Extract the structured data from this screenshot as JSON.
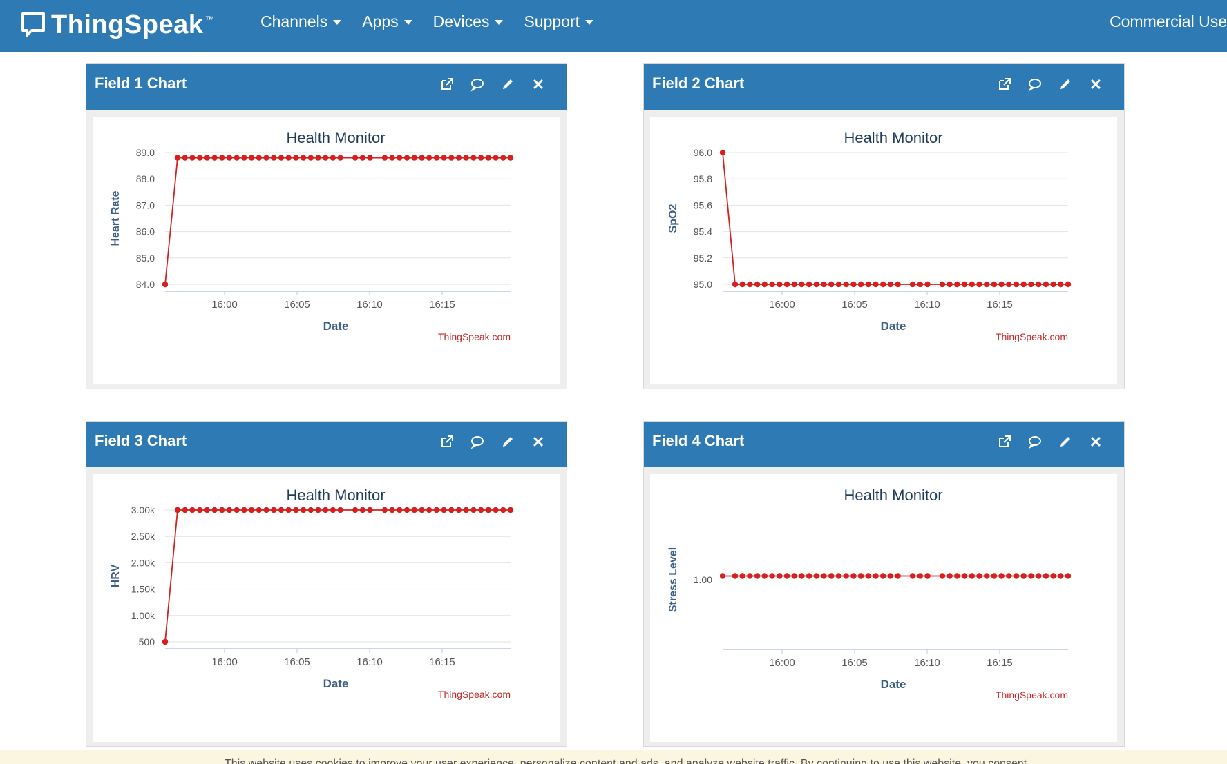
{
  "navbar": {
    "brand": "ThingSpeak",
    "brand_tm": "™",
    "items": [
      {
        "label": "Channels"
      },
      {
        "label": "Apps"
      },
      {
        "label": "Devices"
      },
      {
        "label": "Support"
      }
    ],
    "right_label": "Commercial Use"
  },
  "panels": [
    {
      "title": "Field 1 Chart",
      "tools": [
        "external-link-icon",
        "comment-icon",
        "pencil-icon",
        "close-icon"
      ]
    },
    {
      "title": "Field 2 Chart",
      "tools": [
        "external-link-icon",
        "comment-icon",
        "pencil-icon",
        "close-icon"
      ]
    },
    {
      "title": "Field 3 Chart",
      "tools": [
        "external-link-icon",
        "comment-icon",
        "pencil-icon",
        "close-icon"
      ]
    },
    {
      "title": "Field 4 Chart",
      "tools": [
        "external-link-icon",
        "comment-icon",
        "pencil-icon",
        "close-icon"
      ]
    }
  ],
  "chart_data": [
    {
      "type": "line",
      "title": "Health Monitor",
      "xlabel": "Date",
      "ylabel": "Heart Rate",
      "credit": "ThingSpeak.com",
      "x_ticks": [
        "16:00",
        "16:05",
        "16:10",
        "16:15"
      ],
      "y_ticks": [
        "89.0",
        "88.0",
        "87.0",
        "86.0",
        "85.0",
        "84.0"
      ],
      "ylim": [
        84,
        89
      ],
      "color": "#d62020",
      "series": [
        {
          "first": 84.0,
          "rest": 88.8
        }
      ]
    },
    {
      "type": "line",
      "title": "Health Monitor",
      "xlabel": "Date",
      "ylabel": "SpO2",
      "credit": "ThingSpeak.com",
      "x_ticks": [
        "16:00",
        "16:05",
        "16:10",
        "16:15"
      ],
      "y_ticks": [
        "96.0",
        "95.8",
        "95.6",
        "95.4",
        "95.2",
        "95.0"
      ],
      "ylim": [
        95,
        96
      ],
      "color": "#d62020",
      "series": [
        {
          "first": 96.0,
          "rest": 95.0
        }
      ]
    },
    {
      "type": "line",
      "title": "Health Monitor",
      "xlabel": "Date",
      "ylabel": "HRV",
      "credit": "ThingSpeak.com",
      "x_ticks": [
        "16:00",
        "16:05",
        "16:10",
        "16:15"
      ],
      "y_ticks": [
        "3.00k",
        "2.50k",
        "2.00k",
        "1.50k",
        "1.00k",
        "500"
      ],
      "ylim": [
        200,
        3000
      ],
      "color": "#d62020",
      "series": [
        {
          "first": 200,
          "rest": 3000
        }
      ]
    },
    {
      "type": "line",
      "title": "Health Monitor",
      "xlabel": "Date",
      "ylabel": "Stress Level",
      "credit": "ThingSpeak.com",
      "x_ticks": [
        "16:00",
        "16:05",
        "16:10",
        "16:15"
      ],
      "y_ticks": [
        "1.00"
      ],
      "ylim": [
        0,
        2
      ],
      "color": "#d62020",
      "series": [
        {
          "first": 1.0,
          "rest": 1.0
        }
      ]
    }
  ],
  "cookie_bar": {
    "text": "This website uses cookies to improve your user experience, personalize content and ads, and analyze website traffic. By continuing to use this website, you consent"
  }
}
